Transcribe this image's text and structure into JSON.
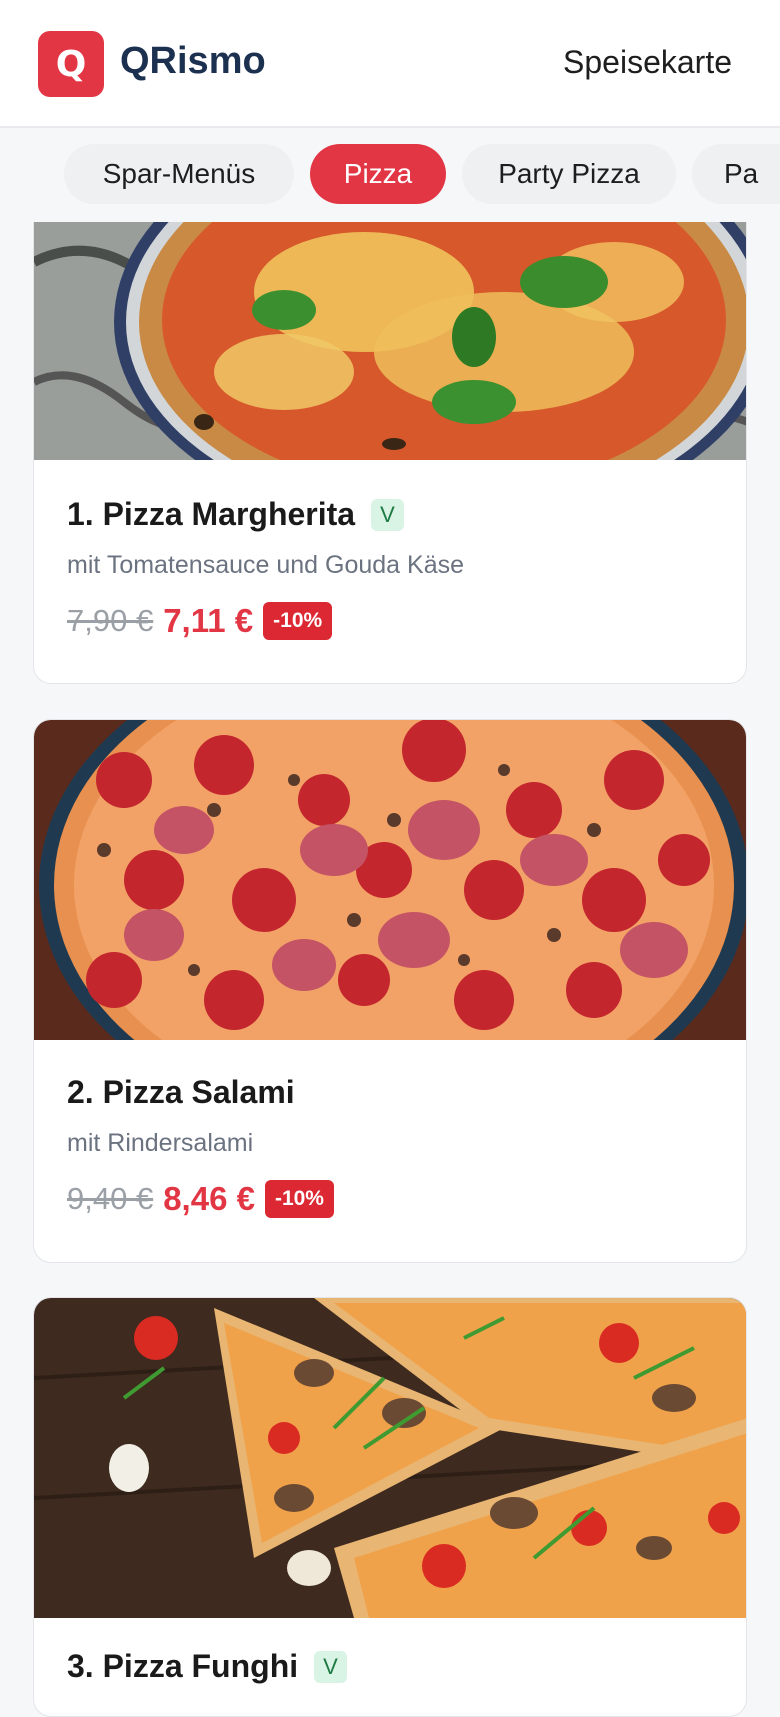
{
  "header": {
    "logo_letter": "Q",
    "brand": "QRismo",
    "nav_label": "Speisekarte"
  },
  "tabs": [
    {
      "label": "Spar-Menüs",
      "active": false
    },
    {
      "label": "Pizza",
      "active": true
    },
    {
      "label": "Party Pizza",
      "active": false
    },
    {
      "label": "Pa",
      "active": false
    }
  ],
  "items": [
    {
      "title": "1. Pizza Margherita",
      "veg_badge": "V",
      "description": "mit Tomatensauce und Gouda Käse",
      "old_price": "7,90 €",
      "new_price": "7,11 €",
      "discount": "-10%"
    },
    {
      "title": "2. Pizza Salami",
      "description": "mit Rindersalami",
      "old_price": "9,40 €",
      "new_price": "8,46 €",
      "discount": "-10%"
    },
    {
      "title": "3. Pizza Funghi",
      "veg_badge": "V"
    }
  ],
  "colors": {
    "accent": "#e23645",
    "brand_text": "#1c3050",
    "veg_bg": "#d9f3e4",
    "discount_bg": "#dc2832"
  }
}
